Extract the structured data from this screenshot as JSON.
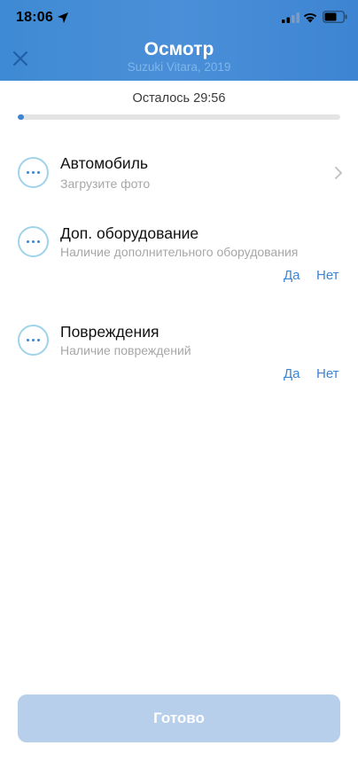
{
  "status_bar": {
    "time": "18:06"
  },
  "header": {
    "title": "Осмотр",
    "subtitle": "Suzuki Vitara, 2019"
  },
  "timer": {
    "text": "Осталось 29:56",
    "progress_fraction": 0.02
  },
  "sections": [
    {
      "title": "Автомобиль",
      "subtitle": "Загрузите фото",
      "icon": "more-dots-icon",
      "has_chevron": true
    },
    {
      "title": "Доп. оборудование",
      "subtitle": "Наличие дополнительного оборудования",
      "icon": "more-dots-icon",
      "yes": "Да",
      "no": "Нет"
    },
    {
      "title": "Повреждения",
      "subtitle": "Наличие повреждений",
      "icon": "more-dots-icon",
      "yes": "Да",
      "no": "Нет"
    }
  ],
  "footer": {
    "done_label": "Готово"
  },
  "colors": {
    "accent": "#3d84d2",
    "header_bg": "#4a8fd8",
    "circle_border": "#9fd3ea",
    "button_disabled": "#b7cfea"
  }
}
